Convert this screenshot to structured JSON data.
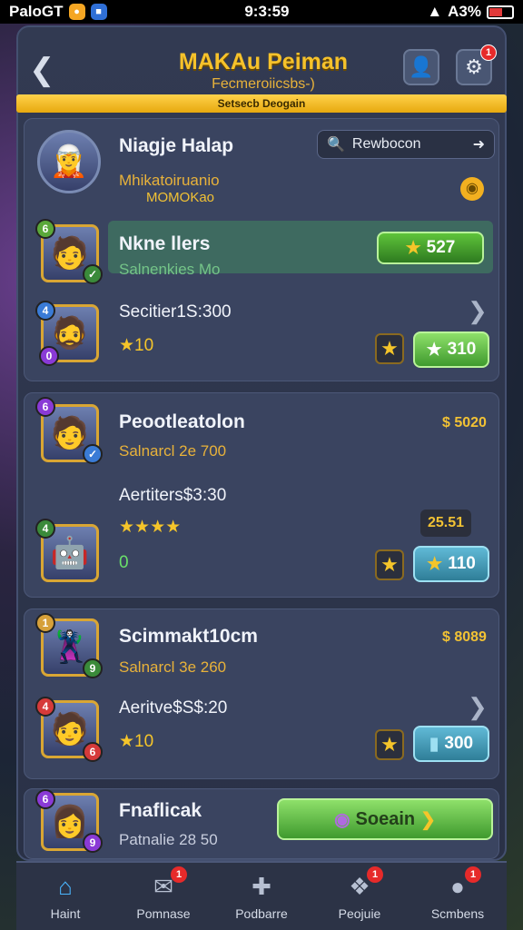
{
  "status_bar": {
    "carrier": "PaloGT",
    "time": "9:3:59",
    "battery_pct": "A3%"
  },
  "header": {
    "title": "MAKAu Peiman",
    "subtitle": "Fecmeroiicsbs-)",
    "banner": "Setsecb Deogain",
    "notif_count": "1"
  },
  "profile": {
    "name": "Niagje Halap",
    "line": "Mhikatoiruanio",
    "line2": "MOMOKao",
    "search_value": "Rewbocon"
  },
  "players": [
    {
      "name": "Nkne llers",
      "sub": "Salnenkies Mo",
      "score": "527",
      "highlight": true
    },
    {
      "stat": "Secitier1S:300",
      "stars": "★10",
      "btn": "310"
    },
    {
      "name": "Peootleatolon",
      "sub": "Salnarcl 2e 700",
      "cost": "$ 5020"
    },
    {
      "stat": "Aertiters$3:30",
      "stars": "★★★★",
      "cost": "25.51",
      "stars2": "0",
      "btn": "110"
    },
    {
      "name": "Scimmakt10cm",
      "sub": "Salnarcl 3e 260",
      "cost": "$ 8089"
    },
    {
      "stat": "Aeritve$S$:20",
      "stars": "★10",
      "btn": "300"
    },
    {
      "name": "Fnaflicak",
      "sub": "Patnalie 28 50",
      "btn": "Soeain"
    }
  ],
  "nav": [
    {
      "label": "Haint",
      "icon": "home-icon",
      "badge": ""
    },
    {
      "label": "Pomnase",
      "icon": "mail-icon",
      "badge": "1"
    },
    {
      "label": "Podbarre",
      "icon": "puzzle-icon",
      "badge": ""
    },
    {
      "label": "Peojuie",
      "icon": "ticket-icon",
      "badge": "1"
    },
    {
      "label": "Scmbens",
      "icon": "chat-icon",
      "badge": "1"
    }
  ]
}
